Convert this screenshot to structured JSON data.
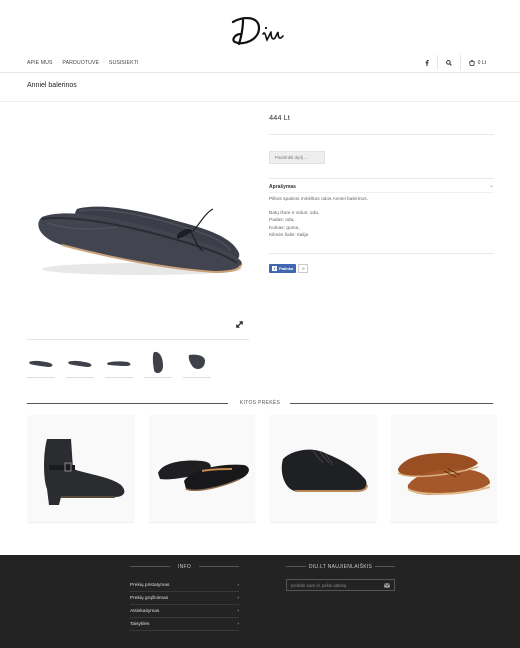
{
  "header": {
    "logo_text": "Diu",
    "nav": [
      "APIE MUS",
      "PARDUOTUVĖ",
      "SUSISIEKTI"
    ],
    "cart_label": "0 Lt",
    "icons": [
      "facebook-icon",
      "search-icon",
      "cart-icon"
    ]
  },
  "product": {
    "title": "Anniel balerinos",
    "price": "444 Lt",
    "size_placeholder": "Pasirinkti dydį ...",
    "description_heading": "Aprašymas",
    "description_intro": "Pilkos spalvos minkštos odos Anniel balerinos.",
    "details": [
      "Batų išorė ir vidus: oda,",
      "Padas: oda,",
      "Kulnas: guma,",
      "Kilmės šalis: Italija"
    ],
    "fb_label": "Patinka",
    "fb_count": "0",
    "thumbnails": 5
  },
  "related": {
    "title": "KITOS PREKĖS"
  },
  "footer": {
    "info_title": "INFO",
    "links": [
      "Prekių pristatymas",
      "Prekių grąžinimas",
      "Atsiskaitymas",
      "Taisyklės"
    ],
    "news_title": "DIU.LT NAUJIENLAIŠKIS",
    "email_placeholder": "Įveskite savo el. pašto adresą"
  },
  "colors": {
    "footer_bg": "#232323",
    "fb_blue": "#4267b2"
  }
}
